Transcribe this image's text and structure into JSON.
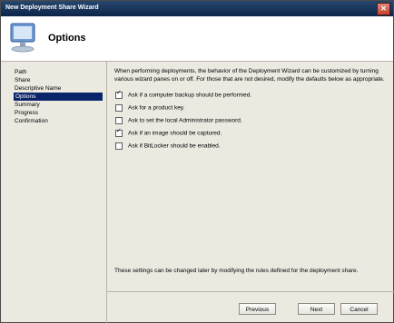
{
  "window": {
    "title": "New Deployment Share Wizard"
  },
  "header": {
    "page_title": "Options",
    "icon": "computer-monitor-icon"
  },
  "steps": [
    {
      "label": "Path",
      "active": false
    },
    {
      "label": "Share",
      "active": false
    },
    {
      "label": "Descriptive Name",
      "active": false
    },
    {
      "label": "Options",
      "active": true
    },
    {
      "label": "Summary",
      "active": false
    },
    {
      "label": "Progress",
      "active": false
    },
    {
      "label": "Confirmation",
      "active": false
    }
  ],
  "content": {
    "intro_line1": "When performing deployments, the behavior of the Deployment Wizard can be customized by turning",
    "intro_line2": "various wizard panes on or off.  For those that are not desired, modify the defaults below as appropriate.",
    "options": [
      {
        "label": "Ask if a computer backup should be performed.",
        "checked": true
      },
      {
        "label": "Ask for a product key.",
        "checked": false
      },
      {
        "label": "Ask to set the local Administrator password.",
        "checked": false
      },
      {
        "label": "Ask if an image should be captured.",
        "checked": true
      },
      {
        "label": "Ask if BitLocker should be enabled.",
        "checked": false
      }
    ],
    "footer_note": "These settings can be changed later by modifying the rules defined for the deployment share."
  },
  "buttons": {
    "previous": "Previous",
    "next": "Next",
    "cancel": "Cancel"
  },
  "colors": {
    "title_bar": "#0c2549",
    "selected_step": "#0a246a",
    "window_bg": "#ece9e1"
  }
}
